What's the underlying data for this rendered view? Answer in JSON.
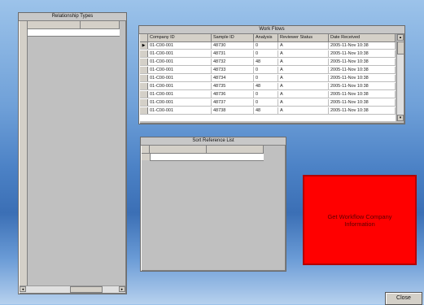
{
  "left_panel": {
    "title": "Relationship Types",
    "columns": [
      "",
      ""
    ]
  },
  "top_table": {
    "title": "Work Flows",
    "columns": [
      "Company ID",
      "Sample ID",
      "Analysis",
      "Reviewer Status",
      "Date Received"
    ],
    "rows": [
      {
        "c1": "01-C00-001",
        "c2": "48730",
        "c3": "0",
        "c4": "A",
        "c5": "2005-11-Nov 10:38"
      },
      {
        "c1": "01-C00-001",
        "c2": "48731",
        "c3": "0",
        "c4": "A",
        "c5": "2005-11-Nov 10:38"
      },
      {
        "c1": "01-C00-001",
        "c2": "48732",
        "c3": "48",
        "c4": "A",
        "c5": "2005-11-Nov 10:38"
      },
      {
        "c1": "01-C00-001",
        "c2": "48733",
        "c3": "0",
        "c4": "A",
        "c5": "2005-11-Nov 10:38"
      },
      {
        "c1": "01-C00-001",
        "c2": "48734",
        "c3": "0",
        "c4": "A",
        "c5": "2005-11-Nov 10:38"
      },
      {
        "c1": "01-C00-001",
        "c2": "48735",
        "c3": "48",
        "c4": "A",
        "c5": "2005-11-Nov 10:38"
      },
      {
        "c1": "01-C00-001",
        "c2": "48736",
        "c3": "0",
        "c4": "A",
        "c5": "2005-11-Nov 10:38"
      },
      {
        "c1": "01-C00-001",
        "c2": "48737",
        "c3": "0",
        "c4": "A",
        "c5": "2005-11-Nov 10:38"
      },
      {
        "c1": "01-C00-001",
        "c2": "48738",
        "c3": "48",
        "c4": "A",
        "c5": "2005-11-Nov 10:38"
      }
    ]
  },
  "mid_panel": {
    "title": "Sort Reference List",
    "columns": [
      "",
      ""
    ]
  },
  "red_button": {
    "label": "Get Workflow Company Information"
  },
  "close_button": {
    "label": "Close"
  },
  "colors": {
    "red": "#ff0000",
    "panel": "#c0c0c0"
  }
}
